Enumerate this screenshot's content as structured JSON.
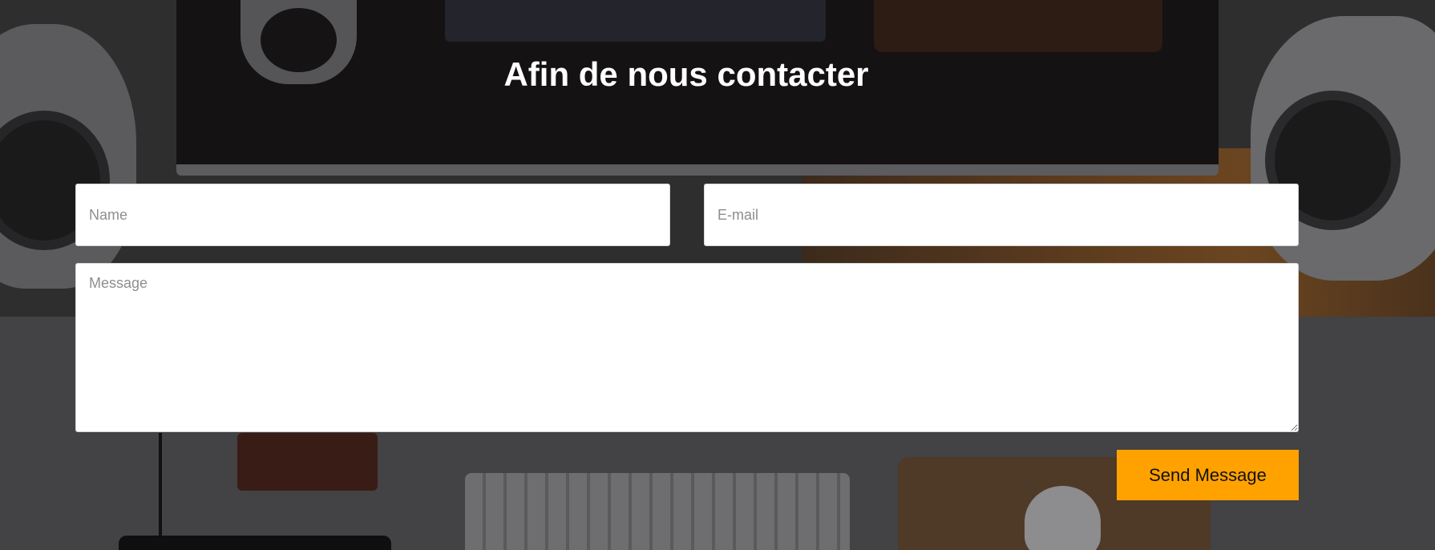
{
  "contact": {
    "title": "Afin de nous contacter",
    "name_placeholder": "Name",
    "email_placeholder": "E-mail",
    "message_placeholder": "Message",
    "submit_label": "Send Message"
  },
  "colors": {
    "accent": "#ffa200",
    "title_text": "#ffffff",
    "field_background": "#ffffff"
  }
}
